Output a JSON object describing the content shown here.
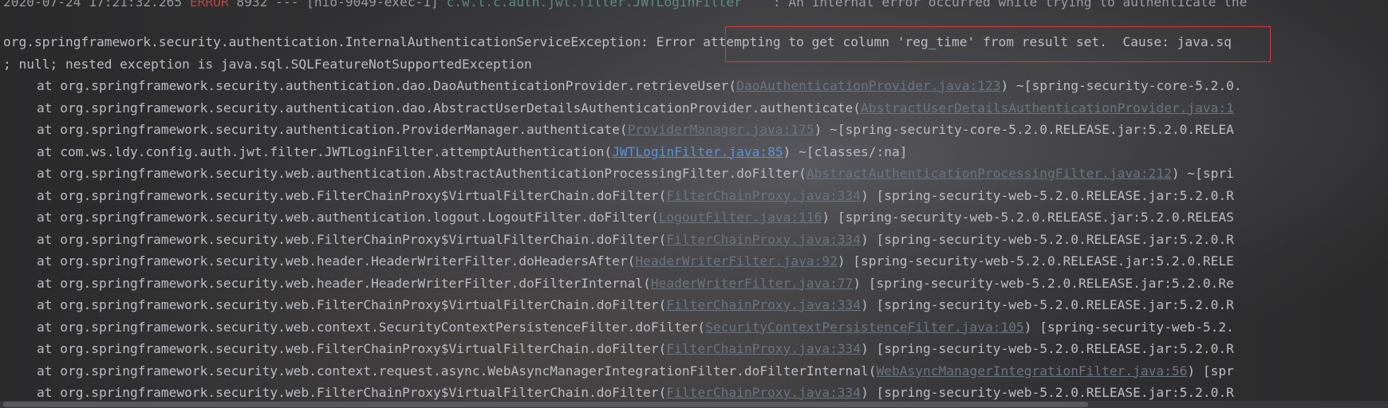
{
  "console": {
    "top_line": {
      "timestamp": "2020-07-24 17:21:32.265",
      "level": "ERROR",
      "pid": "8932",
      "thread": "[nio-9049-exec-1]",
      "logger": "c.w.l.c.auth.jwt.filter.JWTLoginFilter",
      "message": ": An internal error occurred while trying to authenticate the"
    },
    "exception_line": {
      "class_prefix": "org.springframework.security.authentication.InternalAuthenticationServiceException:",
      "highlighted": " Error attempting to get column 'reg_time' from result set.",
      "suffix": "  Cause: java.sq"
    },
    "nested_line": "; null; nested exception is java.sql.SQLFeatureNotSupportedException",
    "frames": [
      {
        "method": "at org.springframework.security.authentication.dao.DaoAuthenticationProvider.retrieveUser(",
        "link": "DaoAuthenticationProvider.java:123",
        "dim": true,
        "tail": ") ~[spring-security-core-5.2.0."
      },
      {
        "method": "at org.springframework.security.authentication.dao.AbstractUserDetailsAuthenticationProvider.authenticate(",
        "link": "AbstractUserDetailsAuthenticationProvider.java:1",
        "dim": true,
        "tail": ""
      },
      {
        "method": "at org.springframework.security.authentication.ProviderManager.authenticate(",
        "link": "ProviderManager.java:175",
        "dim": true,
        "tail": ") ~[spring-security-core-5.2.0.RELEASE.jar:5.2.0.RELEA"
      },
      {
        "method": "at com.ws.ldy.config.auth.jwt.filter.JWTLoginFilter.attemptAuthentication(",
        "link": "JWTLoginFilter.java:85",
        "dim": false,
        "tail": ") ~[classes/:na]"
      },
      {
        "method": "at org.springframework.security.web.authentication.AbstractAuthenticationProcessingFilter.doFilter(",
        "link": "AbstractAuthenticationProcessingFilter.java:212",
        "dim": true,
        "tail": ") ~[spri"
      },
      {
        "method": "at org.springframework.security.web.FilterChainProxy$VirtualFilterChain.doFilter(",
        "link": "FilterChainProxy.java:334",
        "dim": true,
        "tail": ") [spring-security-web-5.2.0.RELEASE.jar:5.2.0.R"
      },
      {
        "method": "at org.springframework.security.web.authentication.logout.LogoutFilter.doFilter(",
        "link": "LogoutFilter.java:116",
        "dim": true,
        "tail": ") [spring-security-web-5.2.0.RELEASE.jar:5.2.0.RELEAS"
      },
      {
        "method": "at org.springframework.security.web.FilterChainProxy$VirtualFilterChain.doFilter(",
        "link": "FilterChainProxy.java:334",
        "dim": true,
        "tail": ") [spring-security-web-5.2.0.RELEASE.jar:5.2.0.R"
      },
      {
        "method": "at org.springframework.security.web.header.HeaderWriterFilter.doHeadersAfter(",
        "link": "HeaderWriterFilter.java:92",
        "dim": true,
        "tail": ") [spring-security-web-5.2.0.RELEASE.jar:5.2.0.RELE"
      },
      {
        "method": "at org.springframework.security.web.header.HeaderWriterFilter.doFilterInternal(",
        "link": "HeaderWriterFilter.java:77",
        "dim": true,
        "tail": ") [spring-security-web-5.2.0.RELEASE.jar:5.2.0.Re"
      },
      {
        "method": "at org.springframework.security.web.FilterChainProxy$VirtualFilterChain.doFilter(",
        "link": "FilterChainProxy.java:334",
        "dim": true,
        "tail": ") [spring-security-web-5.2.0.RELEASE.jar:5.2.0.R"
      },
      {
        "method": "at org.springframework.security.web.context.SecurityContextPersistenceFilter.doFilter(",
        "link": "SecurityContextPersistenceFilter.java:105",
        "dim": true,
        "tail": ") [spring-security-web-5.2."
      },
      {
        "method": "at org.springframework.security.web.FilterChainProxy$VirtualFilterChain.doFilter(",
        "link": "FilterChainProxy.java:334",
        "dim": true,
        "tail": ") [spring-security-web-5.2.0.RELEASE.jar:5.2.0.R"
      },
      {
        "method": "at org.springframework.security.web.context.request.async.WebAsyncManagerIntegrationFilter.doFilterInternal(",
        "link": "WebAsyncManagerIntegrationFilter.java:56",
        "dim": true,
        "tail": ") [spr"
      },
      {
        "method": "at org.springframework.security.web.FilterChainProxy$VirtualFilterChain.doFilter(",
        "link": "FilterChainProxy.java:334",
        "dim": true,
        "tail": ") [spring-security-web-5.2.0.RELEASE.jar:5.2.0.R"
      }
    ]
  },
  "colors": {
    "error": "#e0504a",
    "link": "#5a94d6",
    "highlight_border": "#d9393e"
  }
}
